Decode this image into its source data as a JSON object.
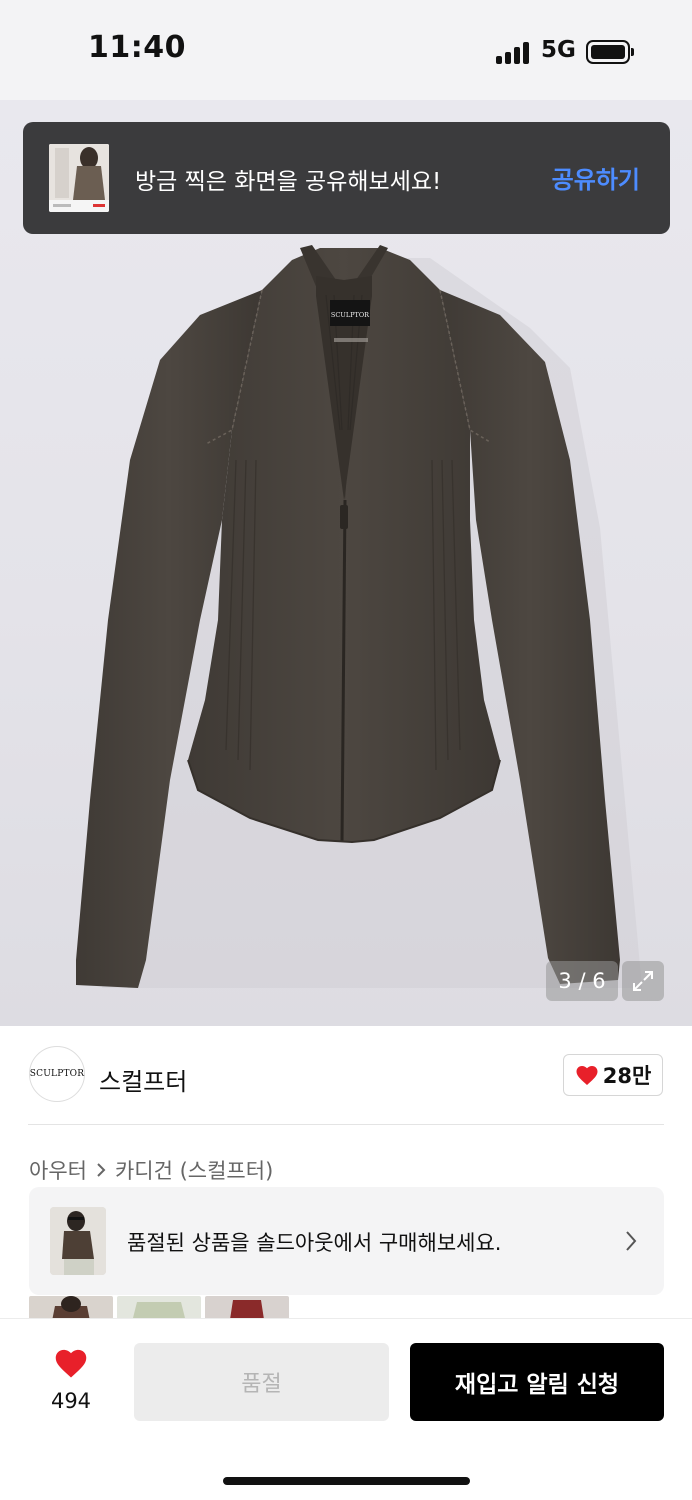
{
  "status_bar": {
    "time": "11:40",
    "network": "5G"
  },
  "share_toast": {
    "message": "방금 찍은 화면을 공유해보세요!",
    "action": "공유하기"
  },
  "gallery": {
    "indicator": "3 / 6",
    "garment_label": "SCULPTOR"
  },
  "brand": {
    "logo_text": "SCULPTOR",
    "name": "스컬프터",
    "likes": "28만"
  },
  "breadcrumb": {
    "level1": "아우터",
    "level2": "카디건 (스컬프터)"
  },
  "soldout_banner": {
    "text": "품절된 상품을 솔드아웃에서 구매해보세요."
  },
  "bottom_bar": {
    "wish_count": "494",
    "soldout_label": "품절",
    "restock_label": "재입고 알림 신청"
  },
  "colors": {
    "accent_blue": "#4d8cff",
    "heart_red": "#e8202a",
    "garment_brown": "#4a4540"
  }
}
